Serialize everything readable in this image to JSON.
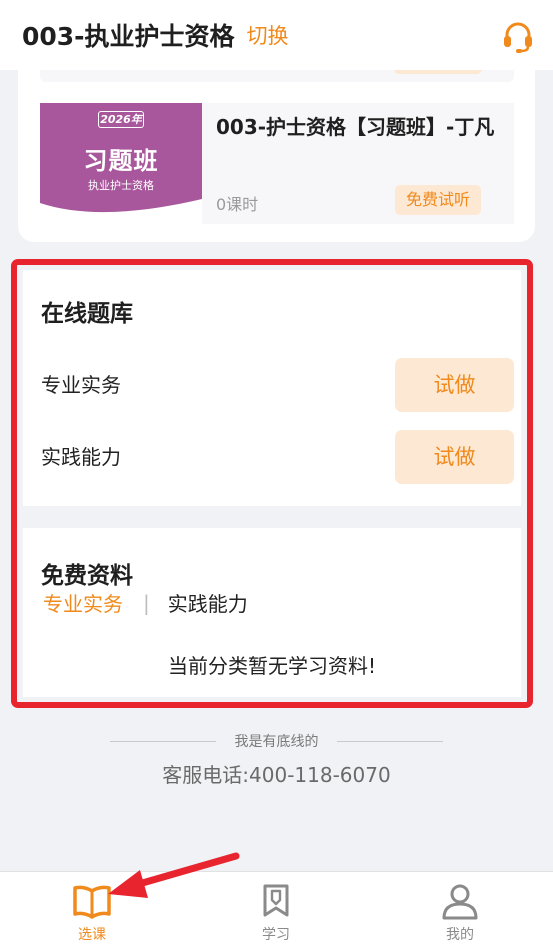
{
  "header": {
    "title": "003-执业护士资格",
    "switch_label": "切换",
    "service_icon": "headset-icon"
  },
  "course": {
    "thumbnail": {
      "year": "2026年",
      "name": "习题班",
      "subtitle": "执业护士资格"
    },
    "title": "003-护士资格【习题班】-丁凡",
    "hours": "0课时",
    "trial_label": "免费试听"
  },
  "question_bank": {
    "title": "在线题库",
    "rows": [
      {
        "label": "专业实务",
        "button": "试做"
      },
      {
        "label": "实践能力",
        "button": "试做"
      }
    ]
  },
  "resources": {
    "title": "免费资料",
    "tabs": [
      "专业实务",
      "实践能力"
    ],
    "tab_separator": "|",
    "empty_text": "当前分类暂无学习资料!"
  },
  "footer": {
    "note": "我是有底线的",
    "hotline": "客服电话:400-118-6070"
  },
  "tabbar": {
    "items": [
      {
        "label": "选课",
        "icon": "book-icon",
        "active": true
      },
      {
        "label": "学习",
        "icon": "bookmark-pencil-icon",
        "active": false
      },
      {
        "label": "我的",
        "icon": "user-icon",
        "active": false
      }
    ]
  },
  "colors": {
    "accent": "#f08a1c",
    "accent_light": "#fde8d4",
    "highlight": "#e8252f",
    "thumbnail_purple": "#a9579c"
  }
}
